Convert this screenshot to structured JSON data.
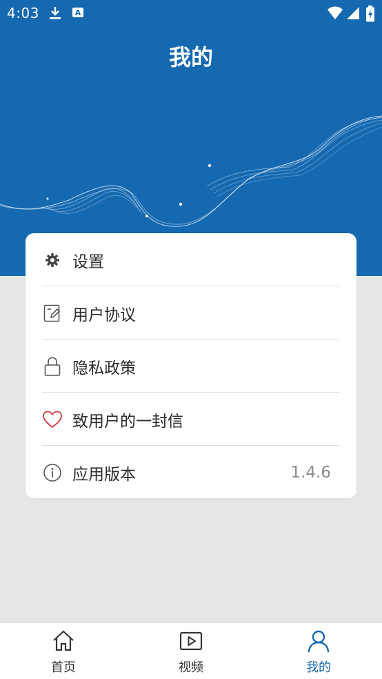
{
  "status_bar": {
    "time": "4:03"
  },
  "header": {
    "title": "我的",
    "background_color": "#1569b1"
  },
  "menu": {
    "items": [
      {
        "label": "设置",
        "icon": "gear-icon",
        "value": ""
      },
      {
        "label": "用户协议",
        "icon": "edit-document-icon",
        "value": ""
      },
      {
        "label": "隐私政策",
        "icon": "lock-icon",
        "value": ""
      },
      {
        "label": "致用户的一封信",
        "icon": "heart-icon",
        "value": "",
        "icon_color": "#d63a3a"
      },
      {
        "label": "应用版本",
        "icon": "info-icon",
        "value": "1.4.6"
      }
    ]
  },
  "bottom_nav": {
    "items": [
      {
        "label": "首页",
        "icon": "home-icon",
        "active": false
      },
      {
        "label": "视频",
        "icon": "video-play-icon",
        "active": false
      },
      {
        "label": "我的",
        "icon": "user-icon",
        "active": true
      }
    ],
    "active_color": "#1569b1"
  }
}
